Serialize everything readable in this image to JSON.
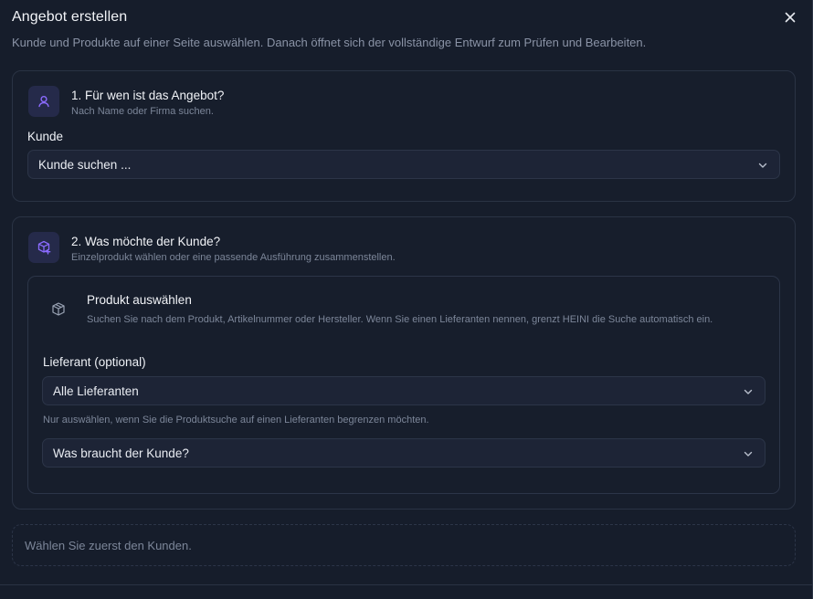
{
  "dialog": {
    "title": "Angebot erstellen",
    "subtitle": "Kunde und Produkte auf einer Seite auswählen. Danach öffnet sich der vollständige Entwurf zum Prüfen und Bearbeiten."
  },
  "step1": {
    "title": "1. Für wen ist das Angebot?",
    "description": "Nach Name oder Firma suchen.",
    "customer_label": "Kunde",
    "customer_select": "Kunde suchen ..."
  },
  "step2": {
    "title": "2. Was möchte der Kunde?",
    "description": "Einzelprodukt wählen oder eine passende Ausführung zusammenstellen.",
    "product": {
      "title": "Produkt auswählen",
      "description": "Suchen Sie nach dem Produkt, Artikelnummer oder Hersteller. Wenn Sie einen Lieferanten nennen, grenzt HEINI die Suche automatisch ein.",
      "supplier_label": "Lieferant (optional)",
      "supplier_select": "Alle Lieferanten",
      "supplier_hint": "Nur auswählen, wenn Sie die Produktsuche auf einen Lieferanten begrenzen möchten.",
      "need_select": "Was braucht der Kunde?"
    }
  },
  "info": {
    "message": "Wählen Sie zuerst den Kunden."
  },
  "icons": {
    "close": "close-icon",
    "step1": "user-icon",
    "step2": "package-plus-icon",
    "product": "package-icon",
    "chevron": "chevron-down-icon"
  },
  "colors": {
    "background": "#161d2b",
    "card_border": "#2a3344",
    "accent": "#7c5cff",
    "icon_bg": "#252a4a"
  }
}
